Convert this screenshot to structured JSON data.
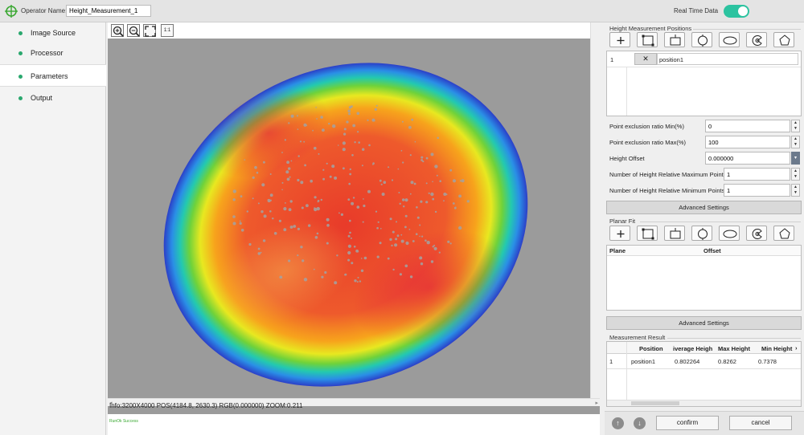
{
  "header": {
    "operator_name_label": "Operator Name:",
    "operator_name_value": "Height_Measurement_1",
    "real_time_label": "Real Time Data",
    "real_time_on": true
  },
  "sidebar": {
    "items": [
      {
        "label": "Image Source"
      },
      {
        "label": "Processor"
      },
      {
        "label": "Parameters"
      },
      {
        "label": "Output"
      }
    ],
    "active": "Parameters"
  },
  "viewer": {
    "zoom_in_icon": "zoom-in-icon",
    "zoom_out_icon": "zoom-out-icon",
    "fit_icon": "fit-screen-icon",
    "actual_size_label": "1:1",
    "info": "Info:3200X4000 POS(4184.8, 2630.3) RGB(0.000000) ZOOM:0.211",
    "status": "RunOk Success"
  },
  "height_positions": {
    "title": "Height Measurement Positions",
    "rows": [
      {
        "index": "1",
        "name": "position1"
      }
    ]
  },
  "params": {
    "min_label": "Point exclusion ratio Min(%)",
    "min_value": "0",
    "max_label": "Point exclusion ratio Max(%)",
    "max_value": "100",
    "offset_label": "Height Offset",
    "offset_value": "0.000000",
    "max_points_label": "Number of Height Relative Maximum Points",
    "max_points_value": "1",
    "min_points_label": "Number of Height Relative Minimum Points",
    "min_points_value": "1",
    "advanced_label": "Advanced Settings"
  },
  "planar_fit": {
    "title": "Planar Fit",
    "col_plane": "Plane",
    "col_offset": "Offset",
    "advanced_label": "Advanced Settings"
  },
  "result": {
    "title": "Measurement Result",
    "columns": [
      "Position",
      "iverage Heigh",
      "Max Height",
      "Min Height"
    ],
    "row_index": "1",
    "row": [
      "position1",
      "0.802264",
      "0.8262",
      "0.7378"
    ]
  },
  "footer": {
    "confirm_label": "confirm",
    "cancel_label": "cancel"
  },
  "colors": {
    "accent": "#2cc3a0",
    "nav_dot": "#2aa86e"
  }
}
